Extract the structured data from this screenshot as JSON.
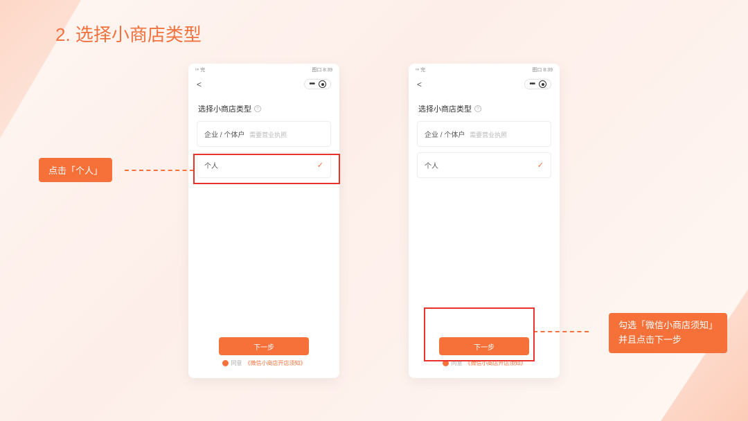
{
  "page_heading": "2. 选择小商店类型",
  "status_bar": {
    "left": "ᵘⁿ 完",
    "right": "图口 8:39"
  },
  "nav": {
    "dots": "•••",
    "back": "<"
  },
  "screen": {
    "title": "选择小商店类型",
    "option_enterprise_label": "企业 / 个体户",
    "option_enterprise_sub": "需要营业执照",
    "option_personal_label": "个人",
    "next_button": "下一步",
    "agree_prefix": "同意",
    "agree_notice": "《微信小商店开店须知》"
  },
  "callouts": {
    "left": "点击「个人」",
    "right_line1": "勾选「微信小商店须知」",
    "right_line2": "并且点击下一步"
  }
}
